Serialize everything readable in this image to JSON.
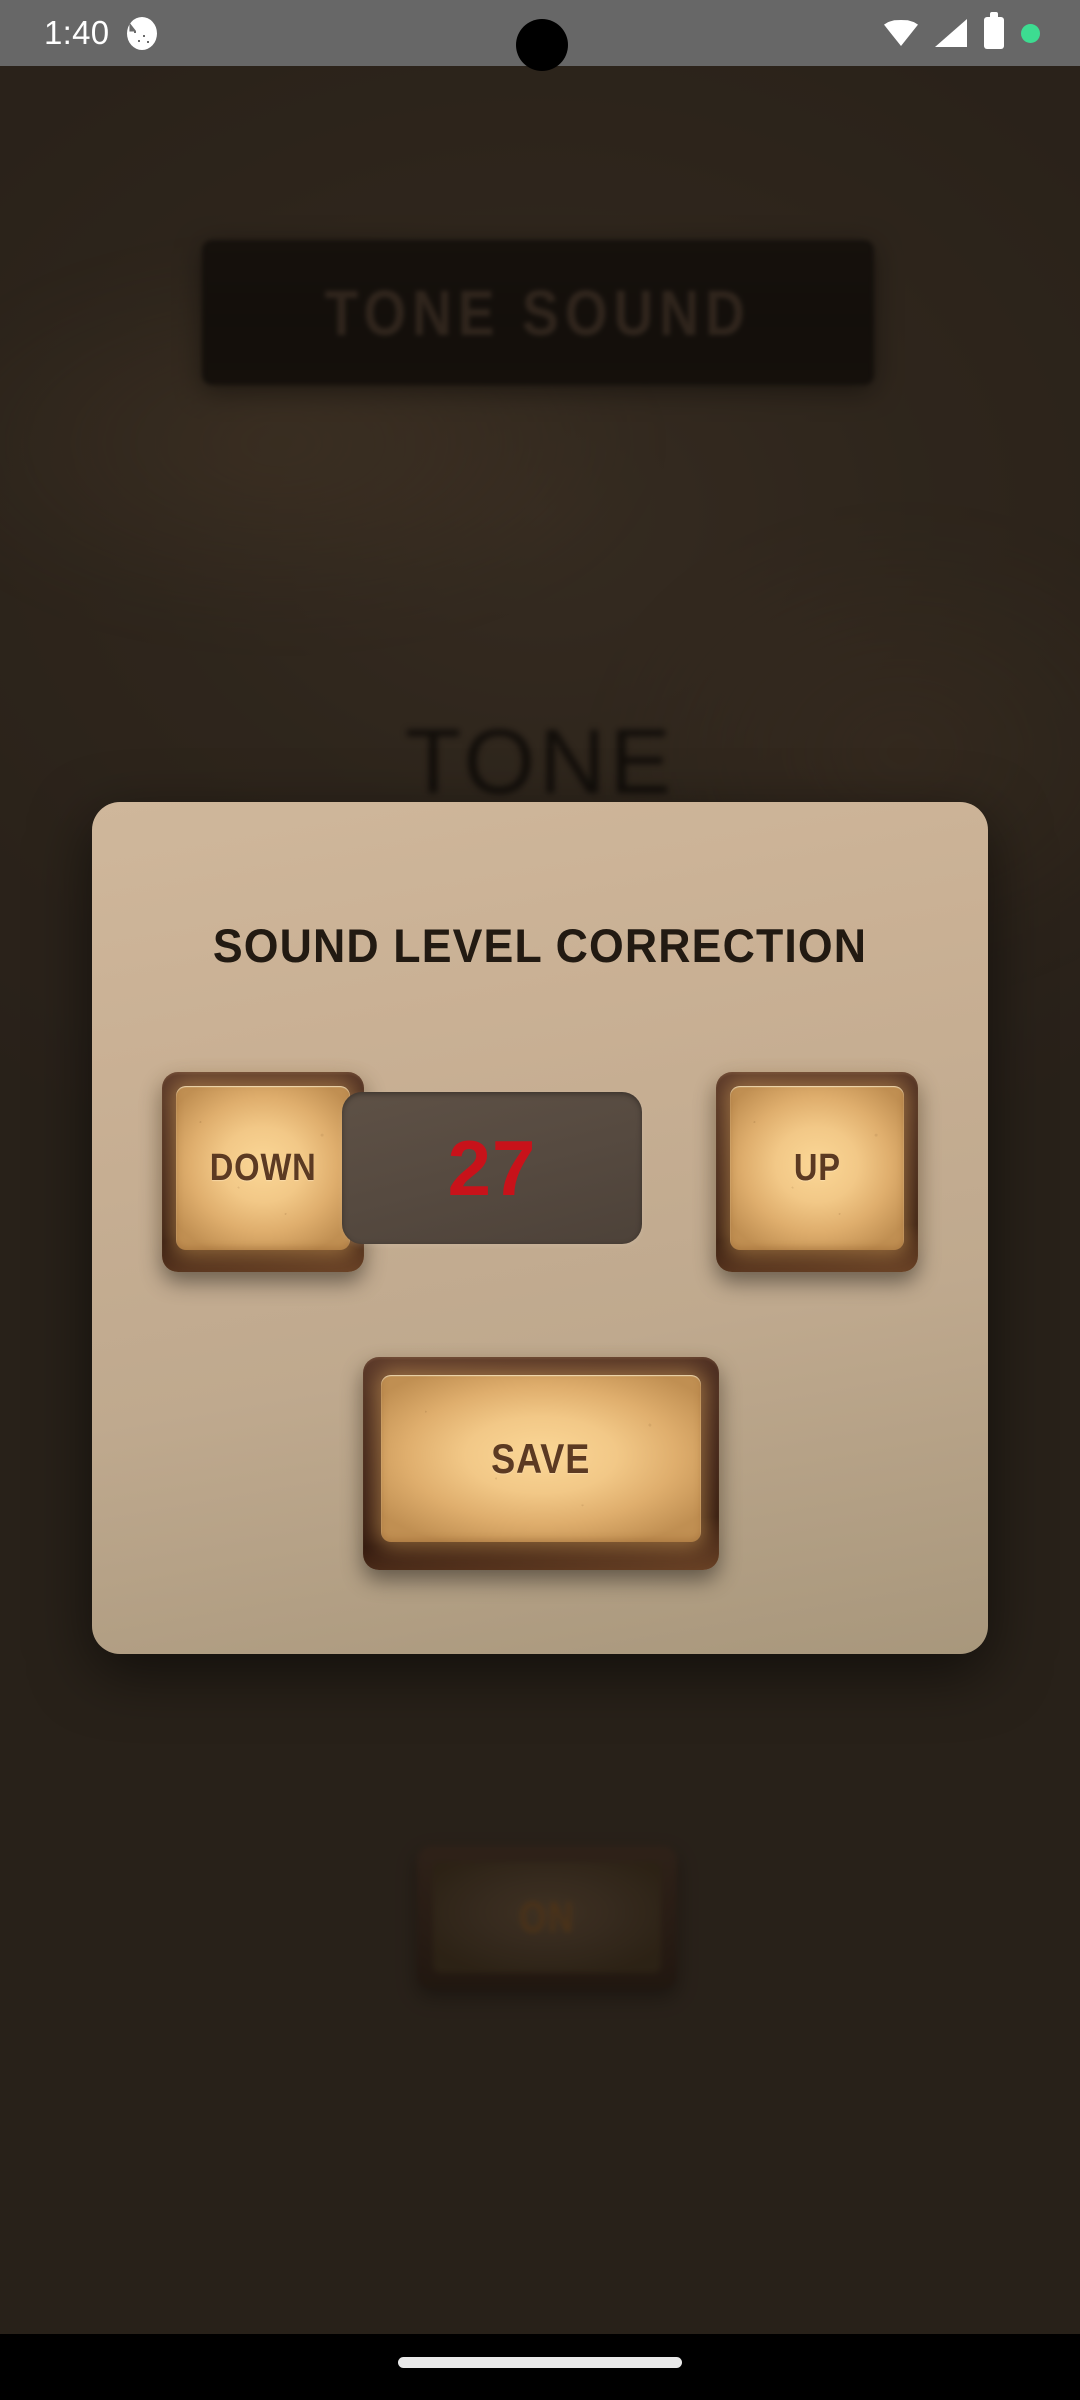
{
  "status_bar": {
    "clock": "1:40",
    "app_icon": "strawberry-app-icon",
    "icons": [
      {
        "name": "wifi-icon",
        "label": "Wi-Fi"
      },
      {
        "name": "cellular-signal-icon",
        "label": "Signal"
      },
      {
        "name": "battery-icon",
        "label": "Battery"
      },
      {
        "name": "recording-indicator-icon",
        "label": "Active"
      }
    ],
    "colors": {
      "background": "#6a6a6a",
      "foreground": "#ffffff",
      "indicator": "#3ddc91"
    }
  },
  "background_app": {
    "header_plaque_text": "TONE SOUND",
    "section_label": "TONE",
    "toggle_button_label": "ON",
    "scrim_color": "#3b322a"
  },
  "dialog": {
    "title": "SOUND LEVEL CORRECTION",
    "background_color": "#c9b094",
    "controls": {
      "decrement_label": "DOWN",
      "increment_label": "UP",
      "value": "27",
      "value_color": "#c8121a",
      "value_background": "#564a40"
    },
    "save_label": "SAVE",
    "button_face_color": "#f2c887",
    "button_bezel_color": "#3b2017",
    "button_text_color": "#5c3a22"
  },
  "nav_bar": {
    "gesture_pill": "home-gesture-pill",
    "background_color": "#000000"
  }
}
